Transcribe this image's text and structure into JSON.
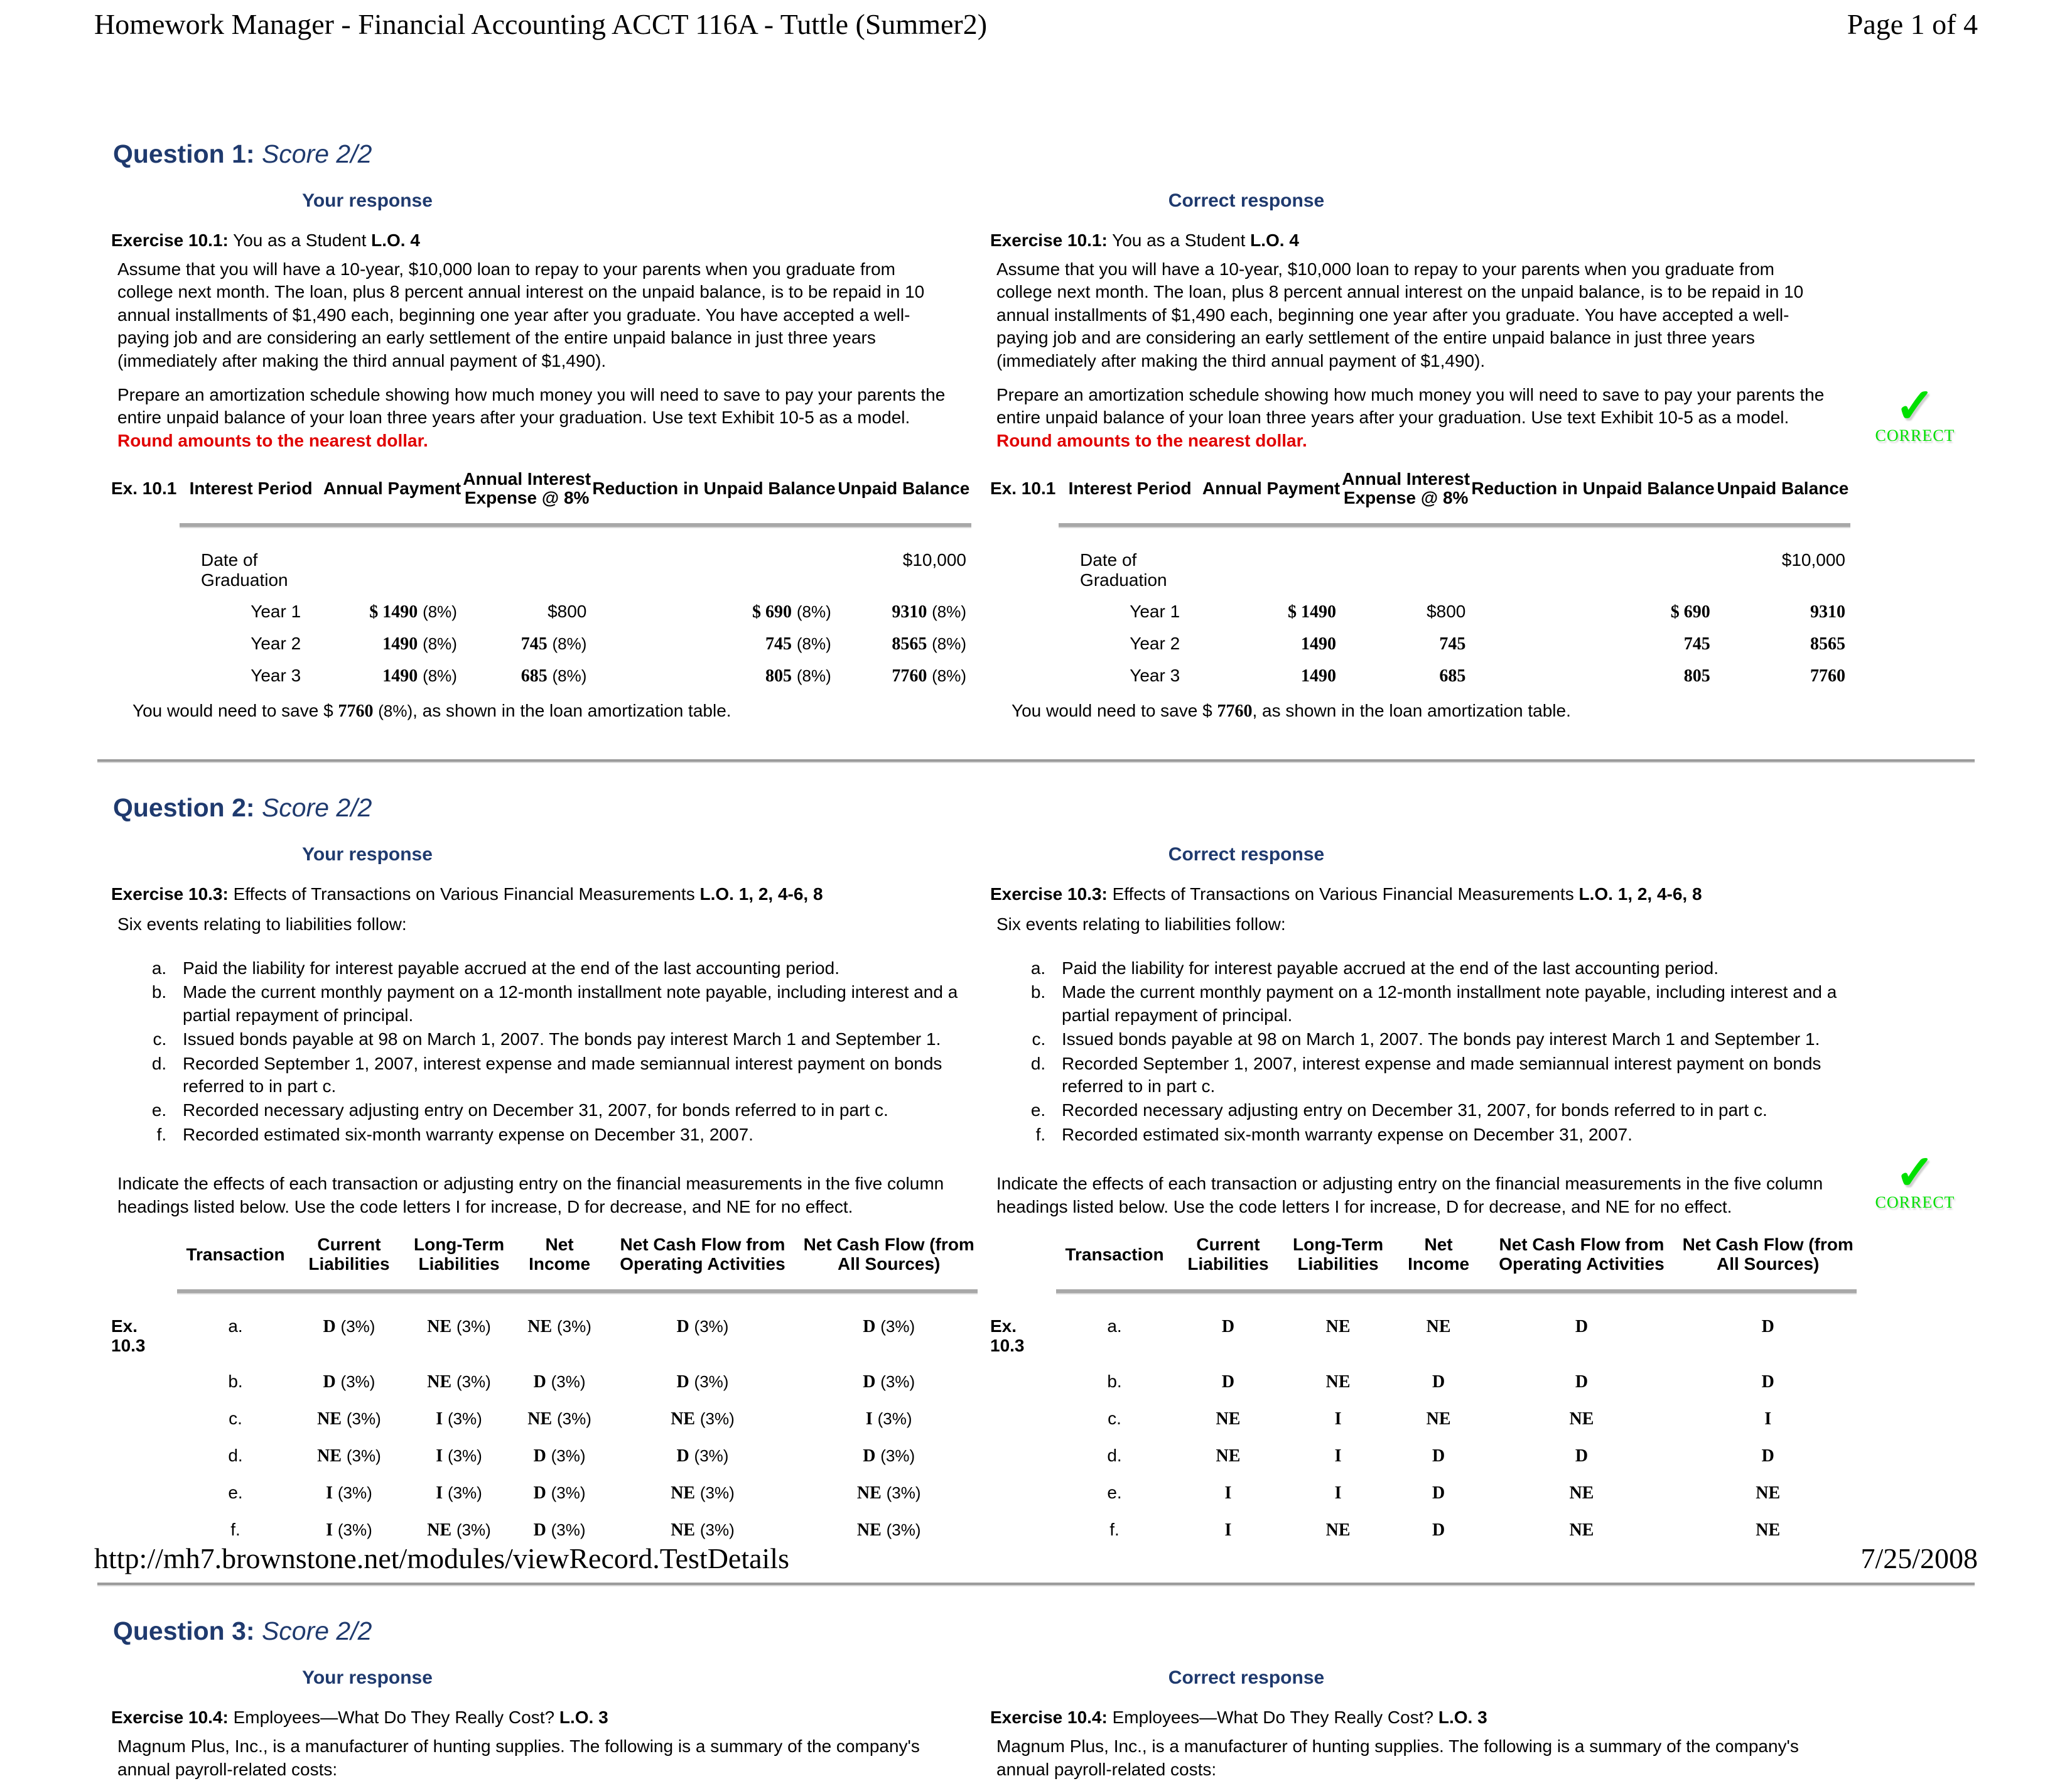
{
  "header": {
    "title": "Homework Manager - Financial Accounting ACCT 116A - Tuttle (Summer2)",
    "page_indicator": "Page 1 of 4"
  },
  "footer": {
    "url": "http://mh7.brownstone.net/modules/viewRecord.TestDetails",
    "date": "7/25/2008"
  },
  "labels": {
    "your_response": "Your response",
    "correct_response": "Correct response",
    "correct_stamp": "CORRECT",
    "check_glyph": "✓"
  },
  "colors": {
    "heading_blue": "#1F3A6E",
    "instruction_red": "#E00000",
    "correct_green": "#00E000",
    "rule_gray": "#9B9B9B"
  },
  "question1": {
    "heading": "Question 1:",
    "score": "Score 2/2",
    "exercise_label": "Exercise 10.1:",
    "exercise_title": "You as a Student",
    "lo": "L.O. 4",
    "para1": "Assume that you will have a 10-year, $10,000 loan to repay to your parents when you graduate from college next month. The loan, plus 8 percent annual interest on the unpaid balance, is to be repaid in 10 annual installments of $1,490 each, beginning one year after you graduate. You have accepted a well-paying job and are considering an early settlement of the entire unpaid balance in just three years (immediately after making the third annual payment of $1,490).",
    "para2": "Prepare an amortization schedule showing how much money you will need to save to pay your parents the entire unpaid balance of your loan three years after your graduation. Use text Exhibit 10-5 as a model.",
    "para2_emphasis": "Round amounts to the nearest dollar.",
    "table": {
      "ex_label": "Ex. 10.1",
      "columns": [
        "Interest Period",
        "Annual Payment",
        "Annual Interest Expense @ 8%",
        "Reduction in Unpaid Balance",
        "Unpaid Balance"
      ],
      "col_interest_expense_line1": "Annual Interest",
      "col_interest_expense_line2": "Expense @ 8%",
      "graduation_row_label": "Date of Graduation",
      "graduation_balance": "$10,000",
      "rows": [
        {
          "period": "Year 1",
          "payment": "$ 1490",
          "interest": "$800",
          "reduction": "$ 690",
          "balance": "9310"
        },
        {
          "period": "Year 2",
          "payment": "1490",
          "interest": "745",
          "reduction": "745",
          "balance": "8565"
        },
        {
          "period": "Year 3",
          "payment": "1490",
          "interest": "685",
          "reduction": "805",
          "balance": "7760"
        }
      ],
      "student_pct_tag": "(8%)",
      "save_prefix": "You would need to save $",
      "save_value": "7760",
      "save_suffix": ", as shown in the loan amortization table."
    }
  },
  "question2": {
    "heading": "Question 2:",
    "score": "Score 2/2",
    "exercise_label": "Exercise 10.3:",
    "exercise_title": "Effects of Transactions on Various Financial Measurements",
    "lo": "L.O. 1, 2, 4-6, 8",
    "intro": "Six events relating to liabilities follow:",
    "events": [
      "Paid the liability for interest payable accrued at the end of the last accounting period.",
      "Made the current monthly payment on a 12-month installment note payable, including interest and a partial repayment of principal.",
      "Issued bonds payable at 98 on March 1, 2007. The bonds pay interest March 1 and September 1.",
      "Recorded September 1, 2007, interest expense and made semiannual interest payment on bonds referred to in part c.",
      "Recorded necessary adjusting entry on December 31, 2007, for bonds referred to in part c.",
      "Recorded estimated six-month warranty expense on December 31, 2007."
    ],
    "instruction": "Indicate the effects of each transaction or adjusting entry on the financial measurements in the five column headings listed below. Use the code letters I for increase, D for decrease, and NE for no effect.",
    "table": {
      "ex_label_line1": "Ex.",
      "ex_label_line2": "10.3",
      "columns": [
        {
          "l1": "Transaction",
          "l2": ""
        },
        {
          "l1": "Current",
          "l2": "Liabilities"
        },
        {
          "l1": "Long-Term",
          "l2": "Liabilities"
        },
        {
          "l1": "Net",
          "l2": "Income"
        },
        {
          "l1": "Net Cash Flow from",
          "l2": "Operating Activities"
        },
        {
          "l1": "Net Cash Flow (from",
          "l2": "All Sources)"
        }
      ],
      "student_pct_tag": "(3%)",
      "rows": [
        {
          "t": "a.",
          "cl": "D",
          "ll": "NE",
          "ni": "NE",
          "op": "D",
          "as": "D"
        },
        {
          "t": "b.",
          "cl": "D",
          "ll": "NE",
          "ni": "D",
          "op": "D",
          "as": "D"
        },
        {
          "t": "c.",
          "cl": "NE",
          "ll": "I",
          "ni": "NE",
          "op": "NE",
          "as": "I"
        },
        {
          "t": "d.",
          "cl": "NE",
          "ll": "I",
          "ni": "D",
          "op": "D",
          "as": "D"
        },
        {
          "t": "e.",
          "cl": "I",
          "ll": "I",
          "ni": "D",
          "op": "NE",
          "as": "NE"
        },
        {
          "t": "f.",
          "cl": "I",
          "ll": "NE",
          "ni": "D",
          "op": "NE",
          "as": "NE"
        }
      ]
    }
  },
  "question3": {
    "heading": "Question 3:",
    "score": "Score 2/2",
    "exercise_label": "Exercise 10.4:",
    "exercise_title": "Employees—What Do They Really Cost?",
    "lo": "L.O. 3",
    "para1": "Magnum Plus, Inc., is a manufacturer of hunting supplies. The following is a summary of the company's annual payroll-related costs:"
  }
}
